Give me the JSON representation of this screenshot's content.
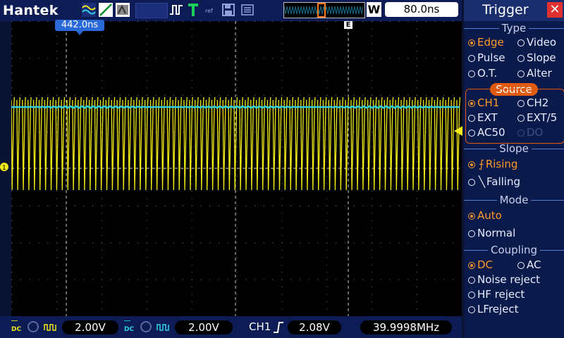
{
  "app": {
    "brand": "Hantek"
  },
  "toolbar": {
    "delay_readout": "442.0ns",
    "w_label": "W",
    "timebase": "80.0ns",
    "trigger_position_marker": "E"
  },
  "bottom": {
    "ch1_volts": "2.00V",
    "ch2_volts": "2.00V",
    "trigger_source": "CH1",
    "trigger_level": "2.08V",
    "frequency": "39.9998MHz"
  },
  "panel": {
    "title": "Trigger",
    "type": {
      "header": "Type",
      "options": [
        "Edge",
        "Video",
        "Pulse",
        "Slope",
        "O.T.",
        "Alter"
      ],
      "selected": "Edge"
    },
    "source": {
      "header": "Source",
      "options": [
        "CH1",
        "CH2",
        "EXT",
        "EXT/5",
        "AC50",
        "DO"
      ],
      "selected": "CH1"
    },
    "slope": {
      "header": "Slope",
      "options": [
        "Rising",
        "Falling"
      ],
      "selected": "Rising"
    },
    "mode": {
      "header": "Mode",
      "options": [
        "Auto",
        "Normal"
      ],
      "selected": "Auto"
    },
    "coupling": {
      "header": "Coupling",
      "options": [
        "DC",
        "AC",
        "Noise reject",
        "HF reject",
        "LFreject"
      ],
      "selected": "DC"
    }
  },
  "colors": {
    "ch1": "#f2ea18",
    "ch2": "#2ed3e6",
    "accent": "#e05a10",
    "selected": "#ff9a2a"
  }
}
